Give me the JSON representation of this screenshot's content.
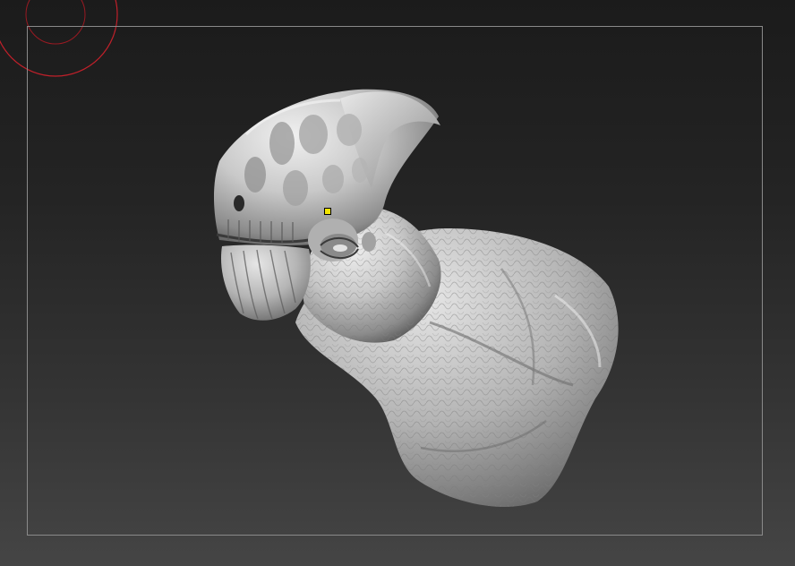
{
  "canvas": {
    "background_top": "#1b1b1b",
    "background_bottom": "#454545",
    "frame_color": "#8a8a8a"
  },
  "brush": {
    "icon": "brush-cursor-icon",
    "outer_color": "#c0202a",
    "inner_color": "#9a1a22"
  },
  "model": {
    "icon": "sculpted-creature-bust",
    "material_color": "#d6d6d6"
  },
  "pivot": {
    "icon": "transpose-pivot-icon",
    "color": "#f2e400"
  }
}
